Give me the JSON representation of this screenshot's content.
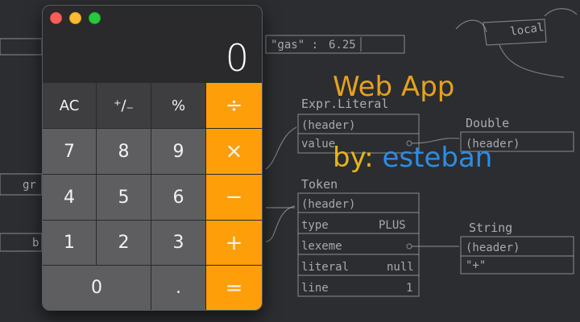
{
  "background": {
    "code_fragments": [
      "\"gas\"  :",
      "6.25",
      "local",
      "Expr.Literal",
      "(header)",
      "value",
      "Double",
      "(header)",
      "Token",
      "(header)",
      "type",
      "PLUS",
      "lexeme",
      "literal",
      "null",
      "line",
      "1",
      "String",
      "(header)",
      "\"+\"",
      "gr",
      "b"
    ],
    "color": "#2b2d30"
  },
  "overlay": {
    "title": "Web App",
    "by_label": "by:",
    "author": "esteban",
    "title_color": "#e6a21c",
    "author_color": "#2f8ce0"
  },
  "calculator": {
    "display": "0",
    "buttons": {
      "ac": "AC",
      "plus_minus": "⁺∕₋",
      "percent": "%",
      "divide": "÷",
      "seven": "7",
      "eight": "8",
      "nine": "9",
      "multiply": "×",
      "four": "4",
      "five": "5",
      "six": "6",
      "minus": "−",
      "one": "1",
      "two": "2",
      "three": "3",
      "plus": "+",
      "zero": "0",
      "decimal": ".",
      "equals": "="
    },
    "colors": {
      "operator": "#fe9f0a",
      "function": "#3e3e40",
      "number": "#5e5e60"
    }
  }
}
